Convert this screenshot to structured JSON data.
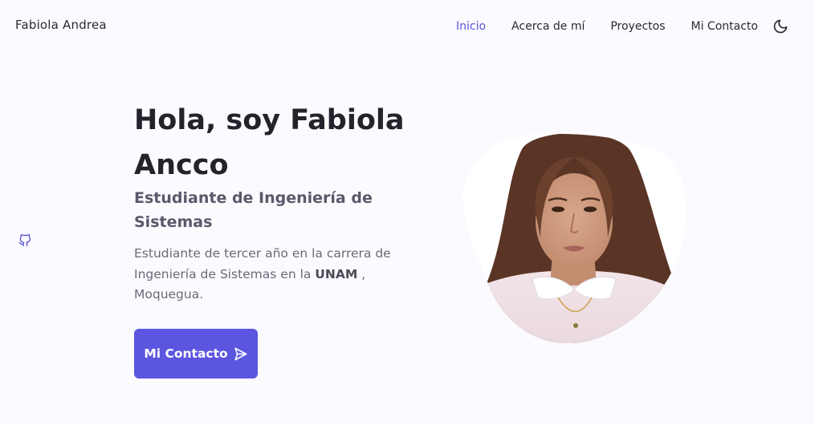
{
  "header": {
    "logo": "Fabiola Andrea",
    "nav": [
      {
        "label": "Inicio",
        "active": true
      },
      {
        "label": "Acerca de mí",
        "active": false
      },
      {
        "label": "Proyectos",
        "active": false
      },
      {
        "label": "Mi Contacto",
        "active": false
      }
    ],
    "theme_icon": "moon-icon"
  },
  "social": {
    "icon": "github-icon"
  },
  "hero": {
    "title": "Hola, soy Fabiola Ancco",
    "subtitle": "Estudiante de Ingeniería de Sistemas",
    "description_before": "Estudiante de tercer año en la carrera de Ingeniería de Sistemas en la ",
    "description_strong": "UNAM",
    "description_after": " , Moquegua.",
    "cta_label": "Mi Contacto",
    "cta_icon": "send-icon",
    "image": "profile-photo"
  },
  "colors": {
    "accent": "#5b55e0",
    "nav_active": "#5b55d3",
    "background": "#fbfaff",
    "title": "#24232c",
    "text": "#6b6a78"
  }
}
